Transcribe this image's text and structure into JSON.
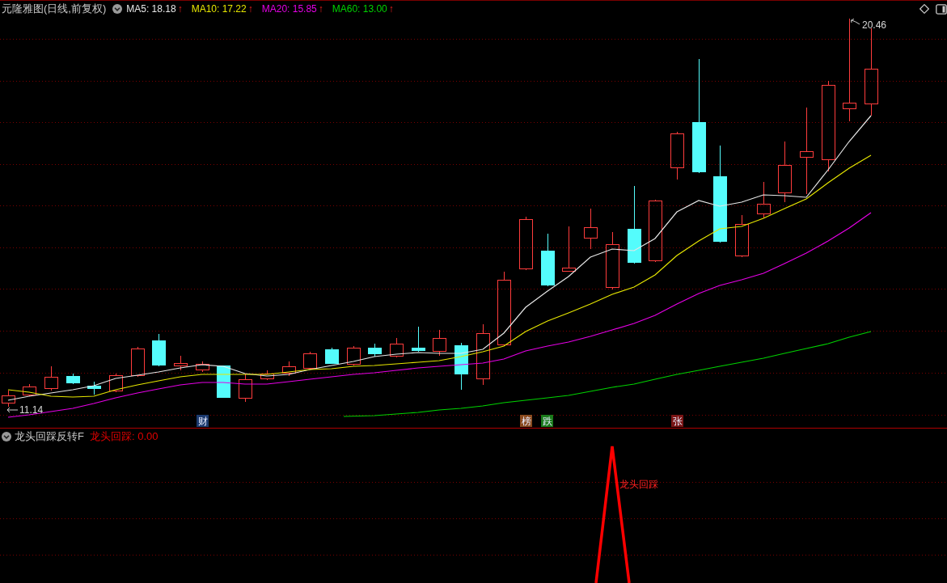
{
  "title": {
    "text": "元隆雅图(日线,前复权)"
  },
  "ma_legend": [
    {
      "label": "MA5: 18.18",
      "color": "#e6e6e6",
      "trend": "↑"
    },
    {
      "label": "MA10: 17.22",
      "color": "#e6e600",
      "trend": "↑"
    },
    {
      "label": "MA20: 15.85",
      "color": "#e600e6",
      "trend": "↑"
    },
    {
      "label": "MA60: 13.00",
      "color": "#00d200",
      "trend": "↑"
    }
  ],
  "price_chart": {
    "high_label": "20.46",
    "low_label": "11.14",
    "markers": [
      {
        "text": "财",
        "color": "#1c3a6e"
      },
      {
        "text": "榜",
        "color": "#8a4a1e"
      },
      {
        "text": "跌",
        "color": "#1a7a1a"
      },
      {
        "text": "张",
        "color": "#7a1414"
      }
    ]
  },
  "indicator": {
    "name": "龙头回踩反转F",
    "reading": "龙头回踩: 0.00",
    "signal_label": "龙头回踩"
  }
}
